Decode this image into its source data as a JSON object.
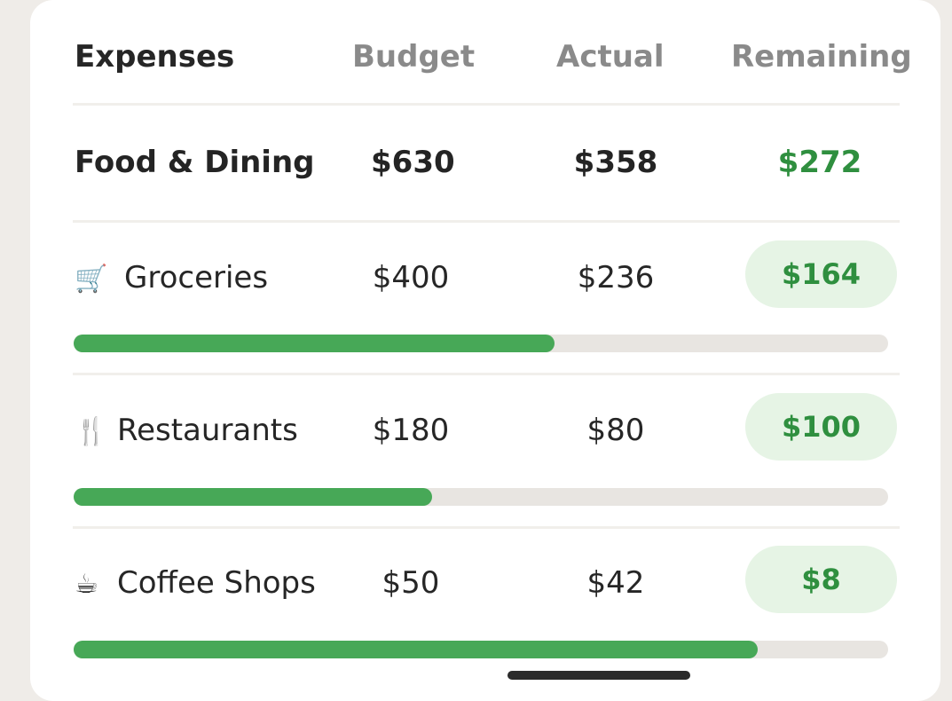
{
  "header": {
    "expenses": "Expenses",
    "budget": "Budget",
    "actual": "Actual",
    "remaining": "Remaining"
  },
  "category": {
    "name": "Food & Dining",
    "budget": "$630",
    "actual": "$358",
    "remaining": "$272"
  },
  "items": [
    {
      "icon": "shopping-cart-icon",
      "glyph": "🛒",
      "name": "Groceries",
      "budget": "$400",
      "actual": "$236",
      "remaining": "$164",
      "progress": 0.59
    },
    {
      "icon": "fork-knife-icon",
      "glyph": "🍴",
      "name": "Restaurants",
      "budget": "$180",
      "actual": "$80",
      "remaining": "$100",
      "progress": 0.44
    },
    {
      "icon": "coffee-cup-icon",
      "glyph": "☕",
      "name": "Coffee Shops",
      "budget": "$50",
      "actual": "$42",
      "remaining": "$8",
      "progress": 0.84
    }
  ],
  "colors": {
    "accent_green": "#47a857",
    "remaining_text": "#2f8f3f",
    "pill_bg": "#e6f4e5",
    "track": "#e8e5e1"
  }
}
